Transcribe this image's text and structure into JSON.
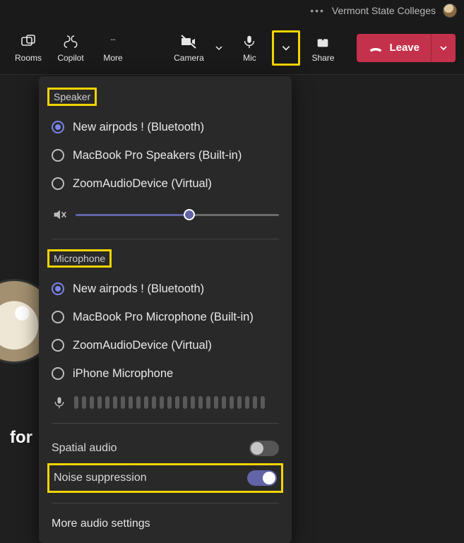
{
  "header": {
    "org": "Vermont State Colleges"
  },
  "toolbar": {
    "rooms": "Rooms",
    "copilot": "Copilot",
    "more": "More",
    "camera": "Camera",
    "mic": "Mic",
    "share": "Share",
    "leave": "Leave"
  },
  "panel": {
    "speaker_label": "Speaker",
    "speakers": [
      {
        "label": "New airpods ! (Bluetooth)",
        "selected": true
      },
      {
        "label": "MacBook Pro Speakers (Built-in)",
        "selected": false
      },
      {
        "label": "ZoomAudioDevice (Virtual)",
        "selected": false
      }
    ],
    "volume_pct": 56,
    "microphone_label": "Microphone",
    "microphones": [
      {
        "label": "New airpods ! (Bluetooth)",
        "selected": true
      },
      {
        "label": "MacBook Pro Microphone (Built-in)",
        "selected": false
      },
      {
        "label": "ZoomAudioDevice (Virtual)",
        "selected": false
      },
      {
        "label": "iPhone Microphone",
        "selected": false
      }
    ],
    "spatial_label": "Spatial audio",
    "spatial_on": false,
    "noise_label": "Noise suppression",
    "noise_on": true,
    "more_settings": "More audio settings"
  },
  "bg_text": "for"
}
